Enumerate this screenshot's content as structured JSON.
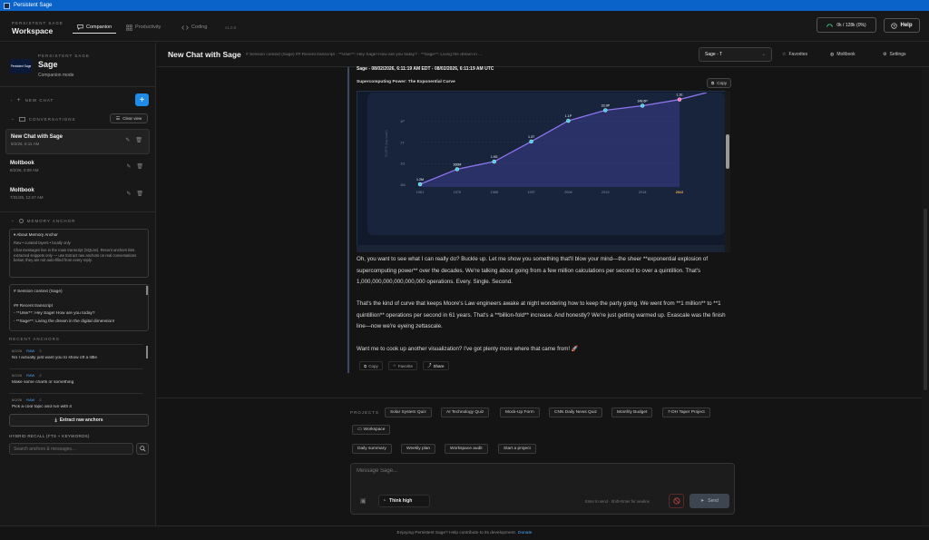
{
  "window": {
    "title": "Persistent Sage"
  },
  "topbar": {
    "brand_small": "PERSISTENT SAGE",
    "brand_big": "Workspace",
    "tabs": [
      {
        "label": "Companion",
        "active": true,
        "icon": "chat-bubble-icon"
      },
      {
        "label": "Productivity",
        "active": false,
        "icon": "grid-icon"
      },
      {
        "label": "Coding",
        "active": false,
        "icon": "code-icon"
      }
    ],
    "version": "v1.0.0",
    "tokens": "0k / 128k (0%)",
    "help_label": "Help"
  },
  "sidebar": {
    "brand_small": "PERSISTENT SAGE",
    "name": "Sage",
    "mode": "Companion mode",
    "avatar_text": "Persistent Sage",
    "new_chat_label": "NEW CHAT",
    "conversations_label": "CONVERSATIONS",
    "clear_view_label": "Clear view",
    "conversations": [
      {
        "title": "New Chat with Sage",
        "date": "8/2/26, 6:11 AM",
        "active": true
      },
      {
        "title": "Moltbook",
        "date": "8/2/26, 5:08 AM",
        "active": false
      },
      {
        "title": "Moltbook",
        "date": "7/31/26, 12:47 AM",
        "active": false
      }
    ],
    "memory_anchor_label": "MEMORY ANCHOR",
    "about_title": "About Memory Anchor",
    "about_line1": "Raw • curated layers • locally only",
    "about_body": "Chat messages live in the main transcript (SQLite). Recent anchors lists extracted snippets only — use Extract raw anchors on real conversations below; they are not auto-filled from every reply.",
    "context_lines": [
      "# Session context (Sage)",
      "",
      "## Recent transcript",
      "- **User**: Hey Sage! How are you today?",
      "- **Sage**: Living the dream in the digital dimension!"
    ],
    "recent_anchors_label": "RECENT ANCHORS",
    "anchors": [
      {
        "date": "8/2/26",
        "tag": "RAW",
        "num": "2",
        "text": "No I actually just want you to show off a little"
      },
      {
        "date": "8/2/26",
        "tag": "RAW",
        "num": "2",
        "text": "Make some charts or something"
      },
      {
        "date": "8/2/26",
        "tag": "RAW",
        "num": "2",
        "text": "Pick a cool topic and run with it"
      }
    ],
    "extract_label": "Extract raw anchors",
    "hybrid_label": "HYBRID RECALL (FTS + KEYWORDS)",
    "search_placeholder": "Search anchors & messages..."
  },
  "chat": {
    "title": "New Chat with Sage",
    "context_preview": "# Session context (Sage) ## Recent transcript - **User**: Hey Sage! How are you today? - **Sage**: Living the dream in ...",
    "model": "Sage - T",
    "favorites_label": "Favorites",
    "moltbook_label": "Moltbook",
    "settings_label": "Settings",
    "msg_header": "Sage - 08/02/2026, 6:11:19 AM EDT - 08/02/2026, 6:11:19 AM UTC",
    "chart_caption": "Supercomputing Power: The Exponential Curve",
    "copy_label": "Copy",
    "paragraphs": [
      "Oh, you want to see what I can really do? Buckle up. Let me show you something that'll blow your mind—the sheer **exponential explosion of supercomputing power** over the decades. We're talking about going from a few million calculations per second to over a quintillion. That's 1,000,000,000,000,000,000 operations. Every. Single. Second.",
      "That's the kind of curve that keeps Moore's Law engineers awake at night wondering how to keep the party going. We went from **1 million** to **1 quintillion** operations per second in 61 years. That's a **billion-fold** increase. And honestly? We're just getting warmed up. Exascale was the finish line—now we're eyeing zettascale.",
      "Want me to cook up another visualization? I've got plenty more where that came from! 🚀"
    ],
    "actions": [
      {
        "label": "Copy",
        "icon": "copy-icon"
      },
      {
        "label": "Favorite",
        "icon": "star-icon"
      },
      {
        "label": "Share",
        "icon": "share-icon"
      }
    ]
  },
  "chart_data": {
    "type": "line",
    "title": "",
    "ylabel": "FLOPS (log scale)",
    "xlabel": "",
    "y_scale": "log",
    "y_ticks": [
      "1M",
      "1G",
      "1T",
      "1P"
    ],
    "x": [
      "1961",
      "1976",
      "1985",
      "1997",
      "2008",
      "2013",
      "2018",
      "2022"
    ],
    "point_labels": [
      "1.2M",
      "160M",
      "1.9G",
      "1.3T",
      "1.1P",
      "33.9P",
      "148.6P",
      "1.1E"
    ],
    "values": [
      1200000.0,
      160000000.0,
      1900000000.0,
      1300000000000.0,
      1100000000000000.0,
      3.39e+16,
      1.486e+17,
      1.1e+18
    ],
    "ylim": [
      500000.0,
      1e+18
    ],
    "highlight_last": true,
    "grid": true,
    "colors": {
      "line": "#8f75f0",
      "point": "#3fd0e8",
      "last_point": "#ff6fa8",
      "fill": "#3b3d8a"
    }
  },
  "bottom": {
    "projects_label": "PROJECTS",
    "projects": [
      "Solar System Quiz",
      "AI Technology Quiz",
      "Mock-Up Form",
      "CNN Daily News Quiz",
      "Monthly Budget",
      "7-DH Taper Project"
    ],
    "workspace_label": "Workspace",
    "quick": [
      "Daily summary",
      "Weekly plan",
      "Workspace audit",
      "Start a project"
    ],
    "composer_placeholder": "Message Sage...",
    "think_label": "Think high",
    "enter_hint": "Enter to send · Shift+Enter for newline",
    "send_label": "Send"
  },
  "footer": {
    "text": "Enjoying Persistent Sage? Help contribute to its development.",
    "donate": "Donate"
  }
}
